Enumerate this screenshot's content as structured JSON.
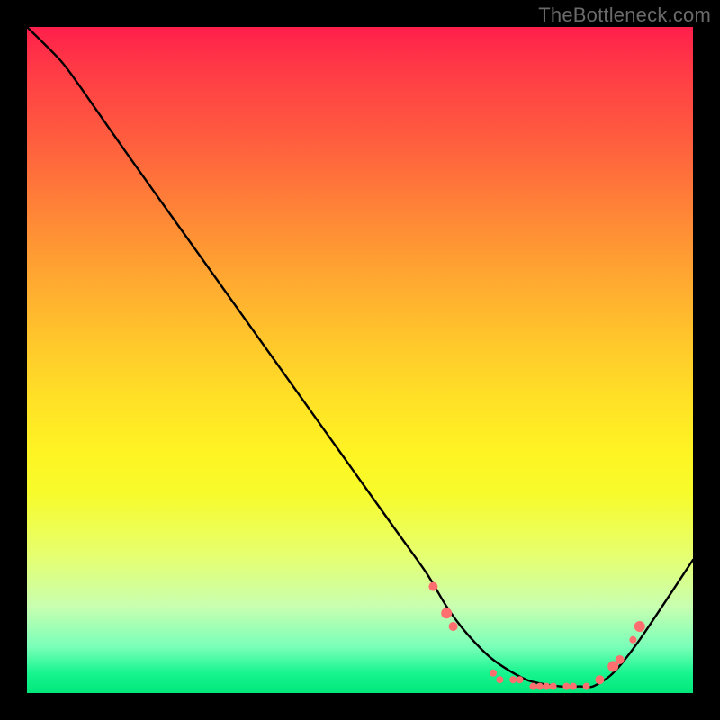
{
  "watermark": "TheBottleneck.com",
  "chart_data": {
    "type": "line",
    "title": "",
    "xlabel": "",
    "ylabel": "",
    "xlim": [
      0,
      100
    ],
    "ylim": [
      0,
      100
    ],
    "grid": false,
    "series": [
      {
        "name": "curve",
        "color": "#000000",
        "x": [
          0,
          5,
          8,
          15,
          25,
          35,
          45,
          55,
          60,
          63,
          66,
          70,
          75,
          80,
          83,
          85,
          88,
          92,
          100
        ],
        "y": [
          100,
          95,
          91,
          81,
          67,
          53,
          39,
          25,
          18,
          13,
          9,
          5,
          2,
          1,
          1,
          1,
          3,
          8,
          20
        ]
      }
    ],
    "markers": [
      {
        "x": 61,
        "y": 16,
        "r": 5,
        "color": "#ff6f6f"
      },
      {
        "x": 63,
        "y": 12,
        "r": 6,
        "color": "#ff6f6f"
      },
      {
        "x": 64,
        "y": 10,
        "r": 5,
        "color": "#ff6f6f"
      },
      {
        "x": 70,
        "y": 3,
        "r": 4,
        "color": "#ff6f6f"
      },
      {
        "x": 71,
        "y": 2,
        "r": 4,
        "color": "#ff6f6f"
      },
      {
        "x": 73,
        "y": 2,
        "r": 4,
        "color": "#ff6f6f"
      },
      {
        "x": 74,
        "y": 2,
        "r": 4,
        "color": "#ff6f6f"
      },
      {
        "x": 76,
        "y": 1,
        "r": 4,
        "color": "#ff6f6f"
      },
      {
        "x": 77,
        "y": 1,
        "r": 4,
        "color": "#ff6f6f"
      },
      {
        "x": 78,
        "y": 1,
        "r": 4,
        "color": "#ff6f6f"
      },
      {
        "x": 79,
        "y": 1,
        "r": 4,
        "color": "#ff6f6f"
      },
      {
        "x": 81,
        "y": 1,
        "r": 4,
        "color": "#ff6f6f"
      },
      {
        "x": 82,
        "y": 1,
        "r": 4,
        "color": "#ff6f6f"
      },
      {
        "x": 84,
        "y": 1,
        "r": 4,
        "color": "#ff6f6f"
      },
      {
        "x": 86,
        "y": 2,
        "r": 5,
        "color": "#ff6f6f"
      },
      {
        "x": 88,
        "y": 4,
        "r": 6,
        "color": "#ff6f6f"
      },
      {
        "x": 89,
        "y": 5,
        "r": 5,
        "color": "#ff6f6f"
      },
      {
        "x": 91,
        "y": 8,
        "r": 4,
        "color": "#ff6f6f"
      },
      {
        "x": 92,
        "y": 10,
        "r": 6,
        "color": "#ff6f6f"
      }
    ]
  }
}
